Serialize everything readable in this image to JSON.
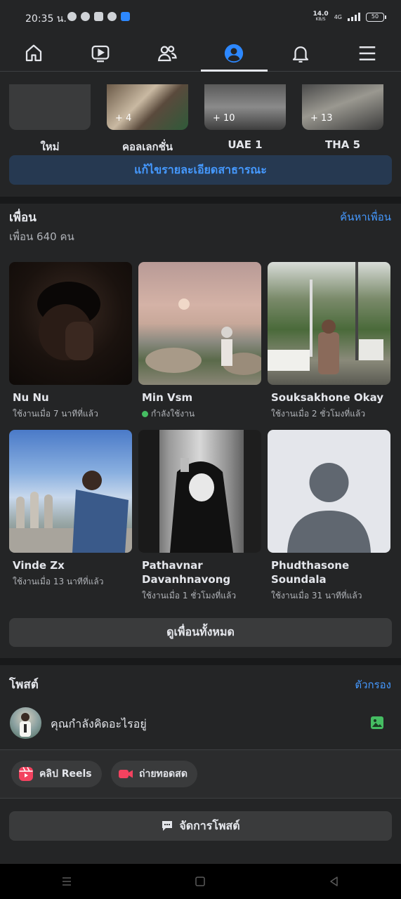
{
  "status_bar": {
    "time": "20:35 น.",
    "net_speed": "14.0",
    "net_unit": "KB/S",
    "network": "4G",
    "battery": "50"
  },
  "tabs": [
    {
      "name": "home",
      "icon": "home-icon"
    },
    {
      "name": "watch",
      "icon": "video-icon"
    },
    {
      "name": "friends",
      "icon": "friends-icon"
    },
    {
      "name": "profile",
      "icon": "profile-icon",
      "active": true
    },
    {
      "name": "notifications",
      "icon": "bell-icon"
    },
    {
      "name": "menu",
      "icon": "menu-icon"
    }
  ],
  "collections": [
    {
      "label": "ใหม่",
      "count": ""
    },
    {
      "label": "คอลเลกชั่น",
      "count": "+ 4"
    },
    {
      "label": "UAE 1",
      "count": "+ 10"
    },
    {
      "label": "THA 5",
      "count": "+ 13"
    }
  ],
  "edit_public_details": "แก้ไขรายละเอียดสาธารณะ",
  "friends": {
    "title": "เพื่อน",
    "count_text": "เพื่อน 640 คน",
    "find_link": "ค้นหาเพื่อน",
    "items": [
      {
        "name": "Nu Nu",
        "status": "ใช้งานเมื่อ 7 นาทีที่แล้ว",
        "online": false
      },
      {
        "name": "Min Vsm",
        "status": "กำลังใช้งาน",
        "online": true
      },
      {
        "name": "Souksakhone Okay",
        "status": "ใช้งานเมื่อ 2 ชั่วโมงที่แล้ว",
        "online": false
      },
      {
        "name": "Vinde Zx",
        "status": "ใช้งานเมื่อ 13 นาทีที่แล้ว",
        "online": false
      },
      {
        "name": "Pathavnar Davanhnavong",
        "status": "ใช้งานเมื่อ 1 ชั่วโมงที่แล้ว",
        "online": false
      },
      {
        "name": "Phudthasone Soundala",
        "status": "ใช้งานเมื่อ 31 นาทีที่แล้ว",
        "online": false
      }
    ],
    "see_all": "ดูเพื่อนทั้งหมด"
  },
  "posts": {
    "title": "โพสต์",
    "filter_link": "ตัวกรอง",
    "composer_prompt": "คุณกำลังคิดอะไรอยู่",
    "reels_label": "คลิป Reels",
    "live_label": "ถ่ายทอดสด",
    "manage_posts": "จัดการโพสต์"
  },
  "colors": {
    "background": "#242526",
    "accent": "#4599ff",
    "online": "#45bd62",
    "reels": "#f3425f"
  }
}
